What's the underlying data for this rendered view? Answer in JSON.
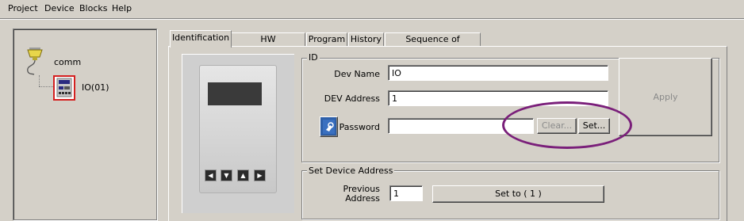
{
  "menu": {
    "items": [
      "Project",
      "Device",
      "Blocks",
      "Help"
    ]
  },
  "tree": {
    "root_label": "comm",
    "child_label": "IO(01)"
  },
  "tabs": [
    {
      "label": "Identification",
      "active": true
    },
    {
      "label": "HW Configuration",
      "active": false
    },
    {
      "label": "Program",
      "active": false
    },
    {
      "label": "History",
      "active": false
    },
    {
      "label": "Sequence of operation",
      "active": false
    }
  ],
  "device_buttons": [
    "◀",
    "▼",
    "▲",
    "▶"
  ],
  "id_group": {
    "title": "ID",
    "dev_name_label": "Dev Name",
    "dev_name_value": "IO",
    "dev_address_label": "DEV Address",
    "dev_address_value": "1",
    "password_label": "Password",
    "password_value": "",
    "clear_label": "Clear...",
    "set_label": "Set...",
    "apply_label": "Apply"
  },
  "set_address_group": {
    "title": "Set Device Address",
    "previous_label_1": "Previous",
    "previous_label_2": "Address",
    "previous_value": "1",
    "set_to_label": "Set to ( 1 )"
  },
  "colors": {
    "highlight_ellipse": "#7a1f7a"
  }
}
